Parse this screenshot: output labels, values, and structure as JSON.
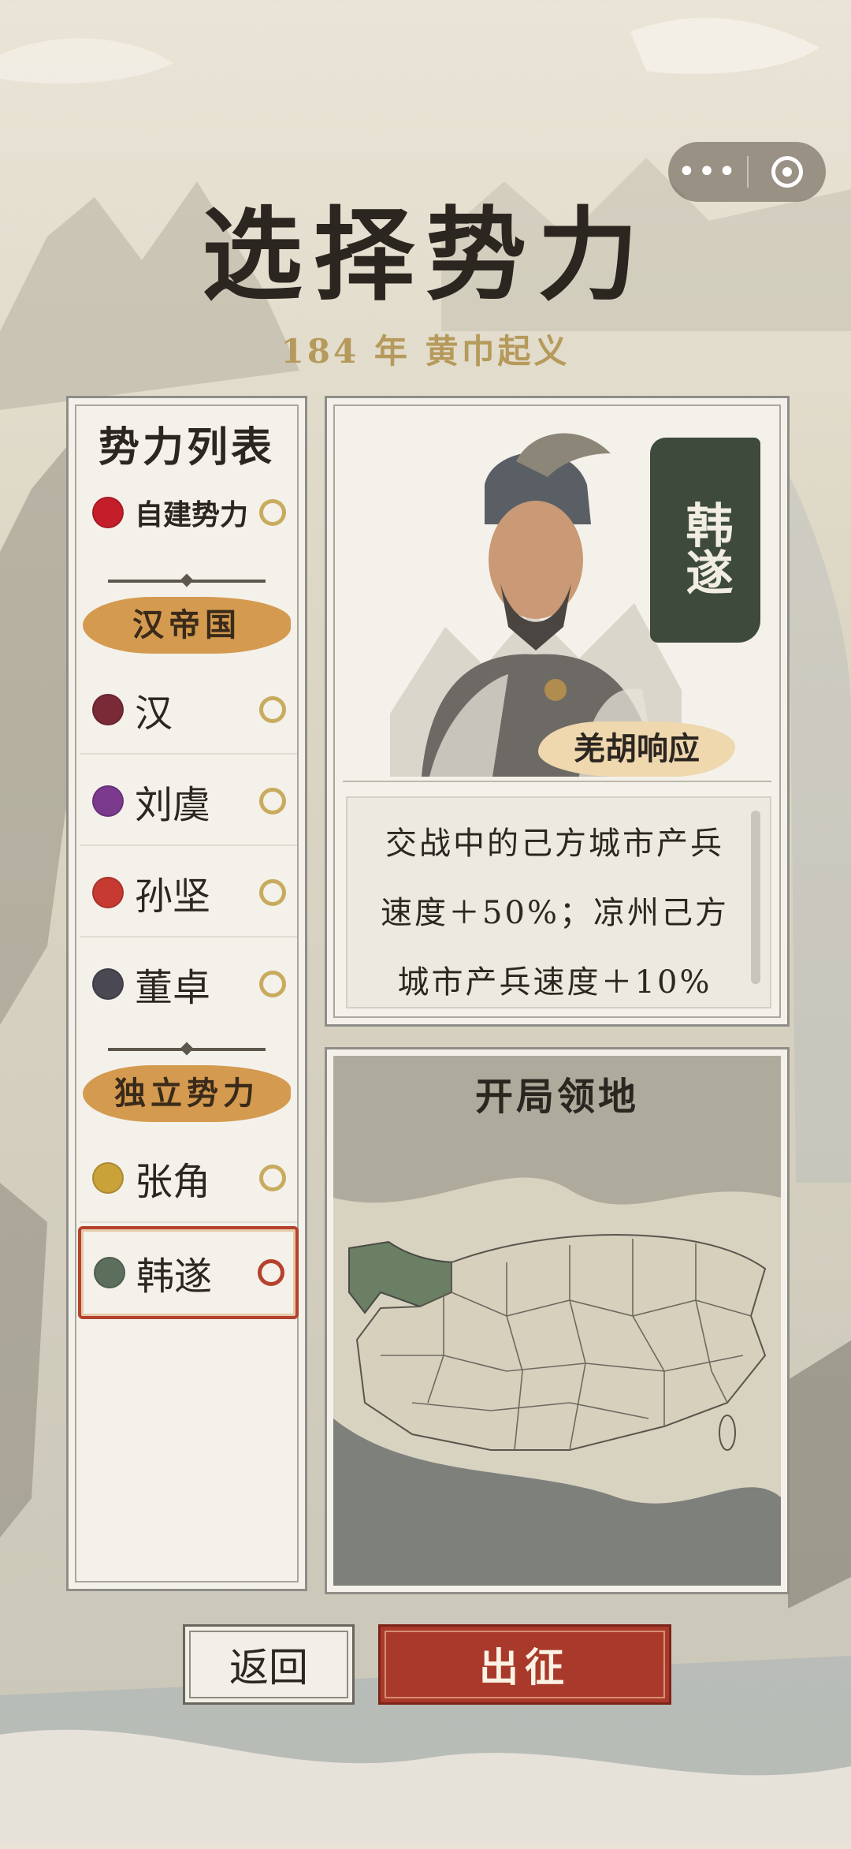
{
  "header": {
    "title": "选择势力",
    "subtitle": "184 年  黄巾起义"
  },
  "capsule": {
    "more_icon": "more-dots-icon",
    "close_icon": "record-icon"
  },
  "faction_list": {
    "heading": "势力列表",
    "custom": {
      "label": "自建势力",
      "color": "#c41e2a"
    },
    "group_han": "汉帝国",
    "han_items": [
      {
        "label": "汉",
        "color": "#7a2a36"
      },
      {
        "label": "刘虞",
        "color": "#7b3a8e"
      },
      {
        "label": "孙坚",
        "color": "#c73a32"
      },
      {
        "label": "董卓",
        "color": "#4a4852"
      }
    ],
    "group_independent": "独立势力",
    "independent_items": [
      {
        "label": "张角",
        "color": "#c9a23a"
      },
      {
        "label": "韩遂",
        "color": "#5c6e5c",
        "selected": true
      }
    ]
  },
  "leader_card": {
    "name": "韩遂",
    "skill_name": "羌胡响应",
    "description": "交战中的己方城市产兵速度＋50%；凉州己方城市产兵速度＋10%"
  },
  "territory": {
    "heading": "开局领地",
    "highlight_color": "#6b7f64"
  },
  "buttons": {
    "back": "返回",
    "go": "出征"
  }
}
